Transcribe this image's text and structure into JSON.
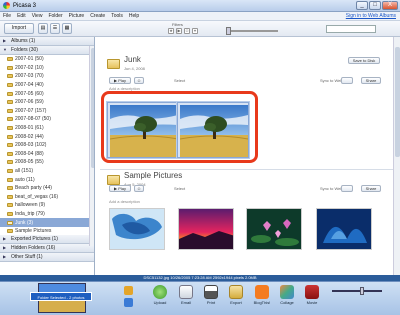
{
  "window": {
    "title": "Picasa 3",
    "minimize": "_",
    "maximize": "□",
    "close": "X"
  },
  "menu": {
    "items": [
      "File",
      "Edit",
      "View",
      "Folder",
      "Picture",
      "Create",
      "Tools",
      "Help"
    ],
    "sign_in": "Sign in to Web Albums"
  },
  "toolbar": {
    "import_label": "Import",
    "filters_label": "Filters"
  },
  "left_panel": {
    "groups_top": [
      {
        "label": "Albums (1)",
        "expanded": false
      },
      {
        "label": "Folders (30)",
        "expanded": true
      }
    ],
    "folders": [
      "2007-01 (50)",
      "2007-02 (10)",
      "2007-03 (70)",
      "2007-04 (40)",
      "2007-05 (60)",
      "2007-06 (59)",
      "2007-07 (157)",
      "2007-08-07 (50)",
      "2008-01 (61)",
      "2008-02 (44)",
      "2008-03 (102)",
      "2008-04 (88)",
      "2008-05 (55)",
      "all (151)",
      "auto (11)",
      "Beach party (44)",
      "beat_of_vegas (16)",
      "halloween (9)",
      "Inda_trip (79)"
    ],
    "selected_folder": "Junk (3)",
    "after_selected": [
      "Sample Pictures"
    ],
    "groups_bottom": [
      "Exported Pictures (1)",
      "Hidden Folders (16)",
      "Other Stuff (1)"
    ]
  },
  "junk_section": {
    "title": "Junk",
    "date": "Jun 4, 2008",
    "play_label": "Play",
    "select_label": "Select",
    "count_label": "2 (or 3) selected",
    "sync_label": "Sync to Web",
    "save_disk_label": "Save to Disk",
    "share_label": "Share",
    "description": "Add a description"
  },
  "sample_section": {
    "title": "Sample Pictures",
    "date": "Aug 5, 2004",
    "play_label": "Play",
    "select_label": "Select",
    "sync_label": "Sync to Web",
    "share_label": "Share",
    "description": "Add a description"
  },
  "status_bar": {
    "text": "DSC51132.jpg   10/26/2005 7:23:28 AM   2592x1944 pixels   2.0MB"
  },
  "tray": {
    "selection_label": "Folder Selected - 2 photos",
    "actions": [
      "Upload",
      "Email",
      "Print",
      "Export",
      "BlogThis!",
      "Collage",
      "Movie"
    ]
  },
  "colors": {
    "highlight": "#e8391b",
    "selected_row": "#8aa8d6",
    "status": "#2b5c9a"
  }
}
